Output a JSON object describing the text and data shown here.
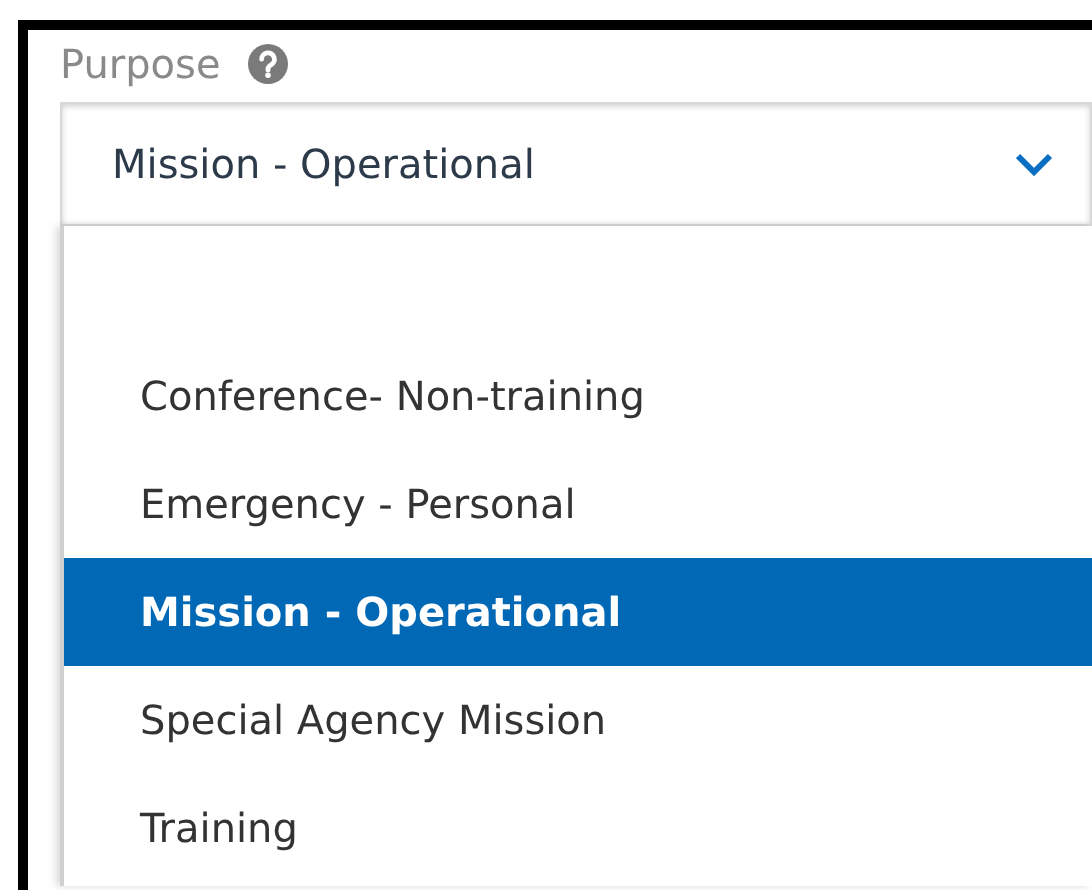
{
  "field": {
    "label": "Purpose",
    "value": "Mission - Operational"
  },
  "options": [
    {
      "label": "Conference- Non-training",
      "selected": false
    },
    {
      "label": "Emergency - Personal",
      "selected": false
    },
    {
      "label": "Mission - Operational",
      "selected": true
    },
    {
      "label": "Special Agency Mission",
      "selected": false
    },
    {
      "label": "Training",
      "selected": false
    }
  ]
}
